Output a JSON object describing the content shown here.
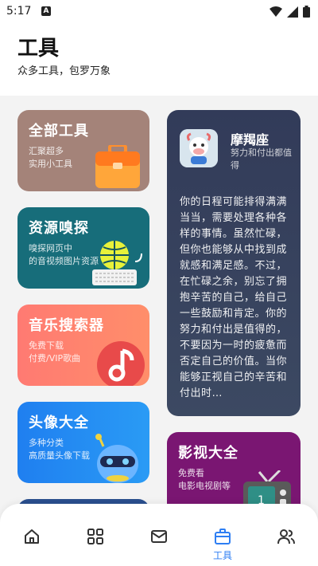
{
  "status": {
    "time": "5:17",
    "notif_icon": "A"
  },
  "header": {
    "title": "工具",
    "subtitle": "众多工具，包罗万象"
  },
  "cards": [
    {
      "title": "全部工具",
      "desc": "汇聚超多\n实用小工具",
      "icon": "toolbox-icon"
    },
    {
      "title": "资源嗅探",
      "desc": "嗅探网页中\n的音视频图片资源",
      "icon": "globe-keyboard-icon"
    },
    {
      "title": "音乐搜索器",
      "desc": "免费下载\n付费/VIP歌曲",
      "icon": "music-note-icon"
    },
    {
      "title": "头像大全",
      "desc": "多种分类\n高质量头像下载",
      "icon": "robot-icon"
    },
    {
      "title": "影视大全",
      "desc": "免费看\n电影电视剧等",
      "icon": "tv-icon"
    }
  ],
  "quote": {
    "name": "摩羯座",
    "sub": "努力和付出都值得",
    "text": "你的日程可能排得满满当当，需要处理各种各样的事情。虽然忙碌，但你也能够从中找到成就感和满足感。不过，在忙碌之余，别忘了拥抱辛苦的自己，给自己一些鼓励和肯定。你的努力和付出是值得的，不要因为一时的疲惫而否定自己的价值。当你能够正视自己的辛苦和付出时…"
  },
  "tabbar": {
    "active_label": "工具"
  },
  "colors": {
    "accent": "#2d7ef3"
  }
}
